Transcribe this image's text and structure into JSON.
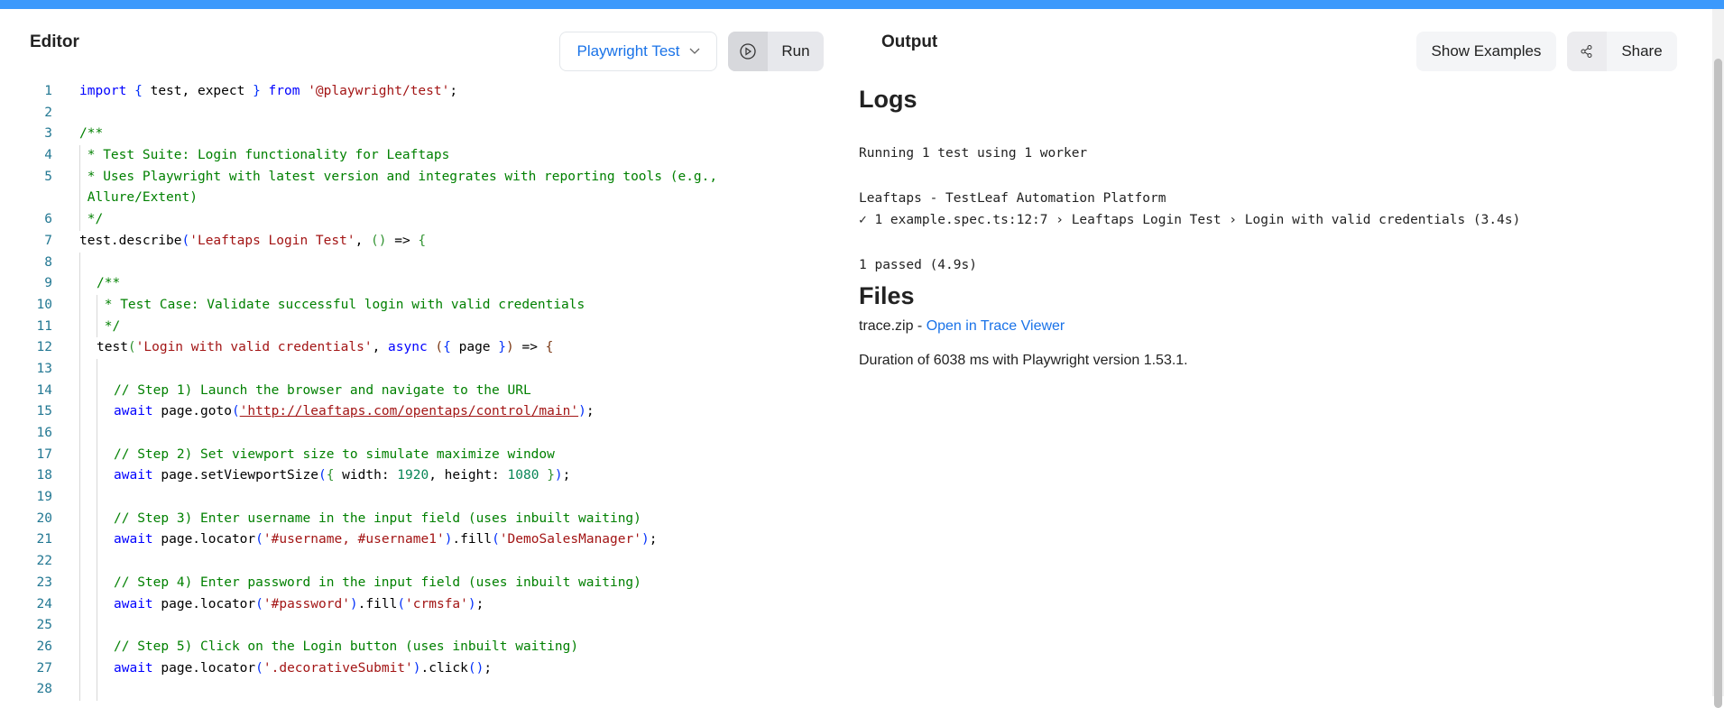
{
  "editor": {
    "title": "Editor",
    "language": "Playwright Test",
    "run_label": "Run"
  },
  "output": {
    "title": "Output",
    "show_examples": "Show Examples",
    "share": "Share",
    "logs_heading": "Logs",
    "logs": [
      "Running 1 test using 1 worker",
      "Leaftaps - TestLeaf Automation Platform",
      "✓ 1 example.spec.ts:12:7 › Leaftaps Login Test › Login with valid credentials (3.4s)",
      "1 passed (4.9s)"
    ],
    "files_heading": "Files",
    "file_name": "trace.zip",
    "file_sep": " - ",
    "trace_link": "Open in Trace Viewer",
    "duration": "Duration of 6038 ms with Playwright version 1.53.1."
  },
  "code": [
    {
      "n": "1",
      "i": 0,
      "t": [
        [
          "kw",
          "import"
        ],
        [
          "pl",
          " "
        ],
        [
          "br1",
          "{"
        ],
        [
          "pl",
          " test, expect "
        ],
        [
          "br1",
          "}"
        ],
        [
          "pl",
          " "
        ],
        [
          "kw",
          "from"
        ],
        [
          "pl",
          " "
        ],
        [
          "str",
          "'@playwright/test'"
        ],
        [
          "pl",
          ";"
        ]
      ]
    },
    {
      "n": "2",
      "i": 0,
      "t": []
    },
    {
      "n": "3",
      "i": 0,
      "t": [
        [
          "com",
          "/**"
        ]
      ]
    },
    {
      "n": "4",
      "i": 0,
      "g": 1,
      "t": [
        [
          "com",
          " * Test Suite: Login functionality for Leaftaps"
        ]
      ]
    },
    {
      "n": "5",
      "i": 0,
      "g": 1,
      "t": [
        [
          "com",
          " * Uses Playwright with latest version and integrates with reporting tools (e.g.,"
        ]
      ]
    },
    {
      "n": "",
      "i": 0,
      "g": 1,
      "t": [
        [
          "com",
          " Allure/Extent)"
        ]
      ]
    },
    {
      "n": "6",
      "i": 0,
      "g": 1,
      "t": [
        [
          "com",
          " */"
        ]
      ]
    },
    {
      "n": "7",
      "i": 0,
      "t": [
        [
          "pl",
          "test.describe"
        ],
        [
          "br1",
          "("
        ],
        [
          "str",
          "'Leaftaps Login Test'"
        ],
        [
          "pl",
          ", "
        ],
        [
          "br2",
          "()"
        ],
        [
          "pl",
          " => "
        ],
        [
          "br2",
          "{"
        ]
      ]
    },
    {
      "n": "8",
      "i": 0,
      "g": 1,
      "t": []
    },
    {
      "n": "9",
      "i": 1,
      "g": 1,
      "t": [
        [
          "com",
          "/**"
        ]
      ]
    },
    {
      "n": "10",
      "i": 1,
      "g": 2,
      "t": [
        [
          "com",
          " * Test Case: Validate successful login with valid credentials"
        ]
      ]
    },
    {
      "n": "11",
      "i": 1,
      "g": 2,
      "t": [
        [
          "com",
          " */"
        ]
      ]
    },
    {
      "n": "12",
      "i": 1,
      "g": 1,
      "t": [
        [
          "pl",
          "test"
        ],
        [
          "br2",
          "("
        ],
        [
          "str",
          "'Login with valid credentials'"
        ],
        [
          "pl",
          ", "
        ],
        [
          "kw",
          "async"
        ],
        [
          "pl",
          " "
        ],
        [
          "br3",
          "("
        ],
        [
          "br1",
          "{"
        ],
        [
          "pl",
          " page "
        ],
        [
          "br1",
          "}"
        ],
        [
          "br3",
          ")"
        ],
        [
          "pl",
          " => "
        ],
        [
          "br3",
          "{"
        ]
      ]
    },
    {
      "n": "13",
      "i": 1,
      "g": 2,
      "t": []
    },
    {
      "n": "14",
      "i": 2,
      "g": 2,
      "t": [
        [
          "com",
          "// Step 1) Launch the browser and navigate to the URL"
        ]
      ]
    },
    {
      "n": "15",
      "i": 2,
      "g": 2,
      "t": [
        [
          "kw",
          "await"
        ],
        [
          "pl",
          " page.goto"
        ],
        [
          "br1",
          "("
        ],
        [
          "str url",
          "'http://leaftaps.com/opentaps/control/main'"
        ],
        [
          "br1",
          ")"
        ],
        [
          "pl",
          ";"
        ]
      ]
    },
    {
      "n": "16",
      "i": 2,
      "g": 2,
      "t": []
    },
    {
      "n": "17",
      "i": 2,
      "g": 2,
      "t": [
        [
          "com",
          "// Step 2) Set viewport size to simulate maximize window"
        ]
      ]
    },
    {
      "n": "18",
      "i": 2,
      "g": 2,
      "t": [
        [
          "kw",
          "await"
        ],
        [
          "pl",
          " page.setViewportSize"
        ],
        [
          "br1",
          "("
        ],
        [
          "br2",
          "{"
        ],
        [
          "pl",
          " width: "
        ],
        [
          "num-lit",
          "1920"
        ],
        [
          "pl",
          ", height: "
        ],
        [
          "num-lit",
          "1080"
        ],
        [
          "pl",
          " "
        ],
        [
          "br2",
          "}"
        ],
        [
          "br1",
          ")"
        ],
        [
          "pl",
          ";"
        ]
      ]
    },
    {
      "n": "19",
      "i": 2,
      "g": 2,
      "t": []
    },
    {
      "n": "20",
      "i": 2,
      "g": 2,
      "t": [
        [
          "com",
          "// Step 3) Enter username in the input field (uses inbuilt waiting)"
        ]
      ]
    },
    {
      "n": "21",
      "i": 2,
      "g": 2,
      "t": [
        [
          "kw",
          "await"
        ],
        [
          "pl",
          " page.locator"
        ],
        [
          "br1",
          "("
        ],
        [
          "str",
          "'#username, #username1'"
        ],
        [
          "br1",
          ")"
        ],
        [
          "pl",
          ".fill"
        ],
        [
          "br1",
          "("
        ],
        [
          "str",
          "'DemoSalesManager'"
        ],
        [
          "br1",
          ")"
        ],
        [
          "pl",
          ";"
        ]
      ]
    },
    {
      "n": "22",
      "i": 2,
      "g": 2,
      "t": []
    },
    {
      "n": "23",
      "i": 2,
      "g": 2,
      "t": [
        [
          "com",
          "// Step 4) Enter password in the input field (uses inbuilt waiting)"
        ]
      ]
    },
    {
      "n": "24",
      "i": 2,
      "g": 2,
      "t": [
        [
          "kw",
          "await"
        ],
        [
          "pl",
          " page.locator"
        ],
        [
          "br1",
          "("
        ],
        [
          "str",
          "'#password'"
        ],
        [
          "br1",
          ")"
        ],
        [
          "pl",
          ".fill"
        ],
        [
          "br1",
          "("
        ],
        [
          "str",
          "'crmsfa'"
        ],
        [
          "br1",
          ")"
        ],
        [
          "pl",
          ";"
        ]
      ]
    },
    {
      "n": "25",
      "i": 2,
      "g": 2,
      "t": []
    },
    {
      "n": "26",
      "i": 2,
      "g": 2,
      "t": [
        [
          "com",
          "// Step 5) Click on the Login button (uses inbuilt waiting)"
        ]
      ]
    },
    {
      "n": "27",
      "i": 2,
      "g": 2,
      "t": [
        [
          "kw",
          "await"
        ],
        [
          "pl",
          " page.locator"
        ],
        [
          "br1",
          "("
        ],
        [
          "str",
          "'.decorativeSubmit'"
        ],
        [
          "br1",
          ")"
        ],
        [
          "pl",
          ".click"
        ],
        [
          "br1",
          "()"
        ],
        [
          "pl",
          ";"
        ]
      ]
    },
    {
      "n": "28",
      "i": 2,
      "g": 2,
      "t": []
    }
  ]
}
